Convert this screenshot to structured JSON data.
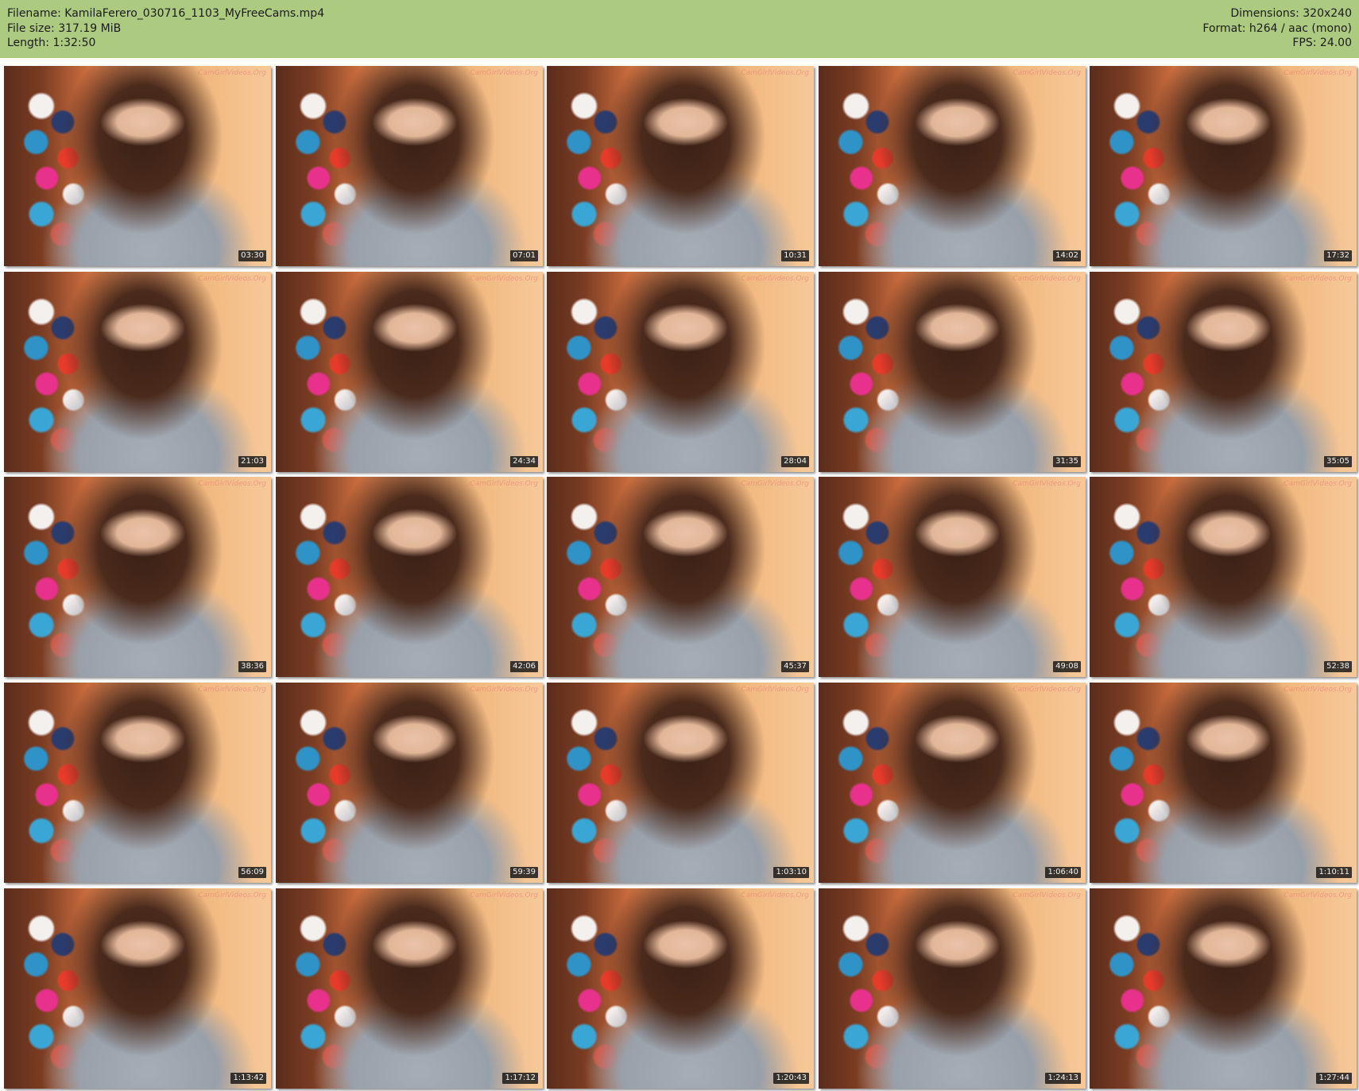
{
  "header": {
    "filename_line": "Filename: KamilaFerero_030716_1103_MyFreeCams.mp4",
    "filesize_line": "File size: 317.19 MiB",
    "length_line": "Length: 1:32:50",
    "dimensions_line": "Dimensions: 320x240",
    "format_line": "Format: h264 / aac (mono)",
    "fps_line": "FPS: 24.00"
  },
  "watermark": "CamGirlVideos.Org",
  "thumbnails": [
    {
      "time": "03:30"
    },
    {
      "time": "07:01"
    },
    {
      "time": "10:31"
    },
    {
      "time": "14:02"
    },
    {
      "time": "17:32"
    },
    {
      "time": "21:03"
    },
    {
      "time": "24:34"
    },
    {
      "time": "28:04"
    },
    {
      "time": "31:35"
    },
    {
      "time": "35:05"
    },
    {
      "time": "38:36"
    },
    {
      "time": "42:06"
    },
    {
      "time": "45:37"
    },
    {
      "time": "49:08"
    },
    {
      "time": "52:38"
    },
    {
      "time": "56:09"
    },
    {
      "time": "59:39"
    },
    {
      "time": "1:03:10"
    },
    {
      "time": "1:06:40"
    },
    {
      "time": "1:10:11"
    },
    {
      "time": "1:13:42"
    },
    {
      "time": "1:17:12"
    },
    {
      "time": "1:20:43"
    },
    {
      "time": "1:24:13"
    },
    {
      "time": "1:27:44"
    }
  ]
}
